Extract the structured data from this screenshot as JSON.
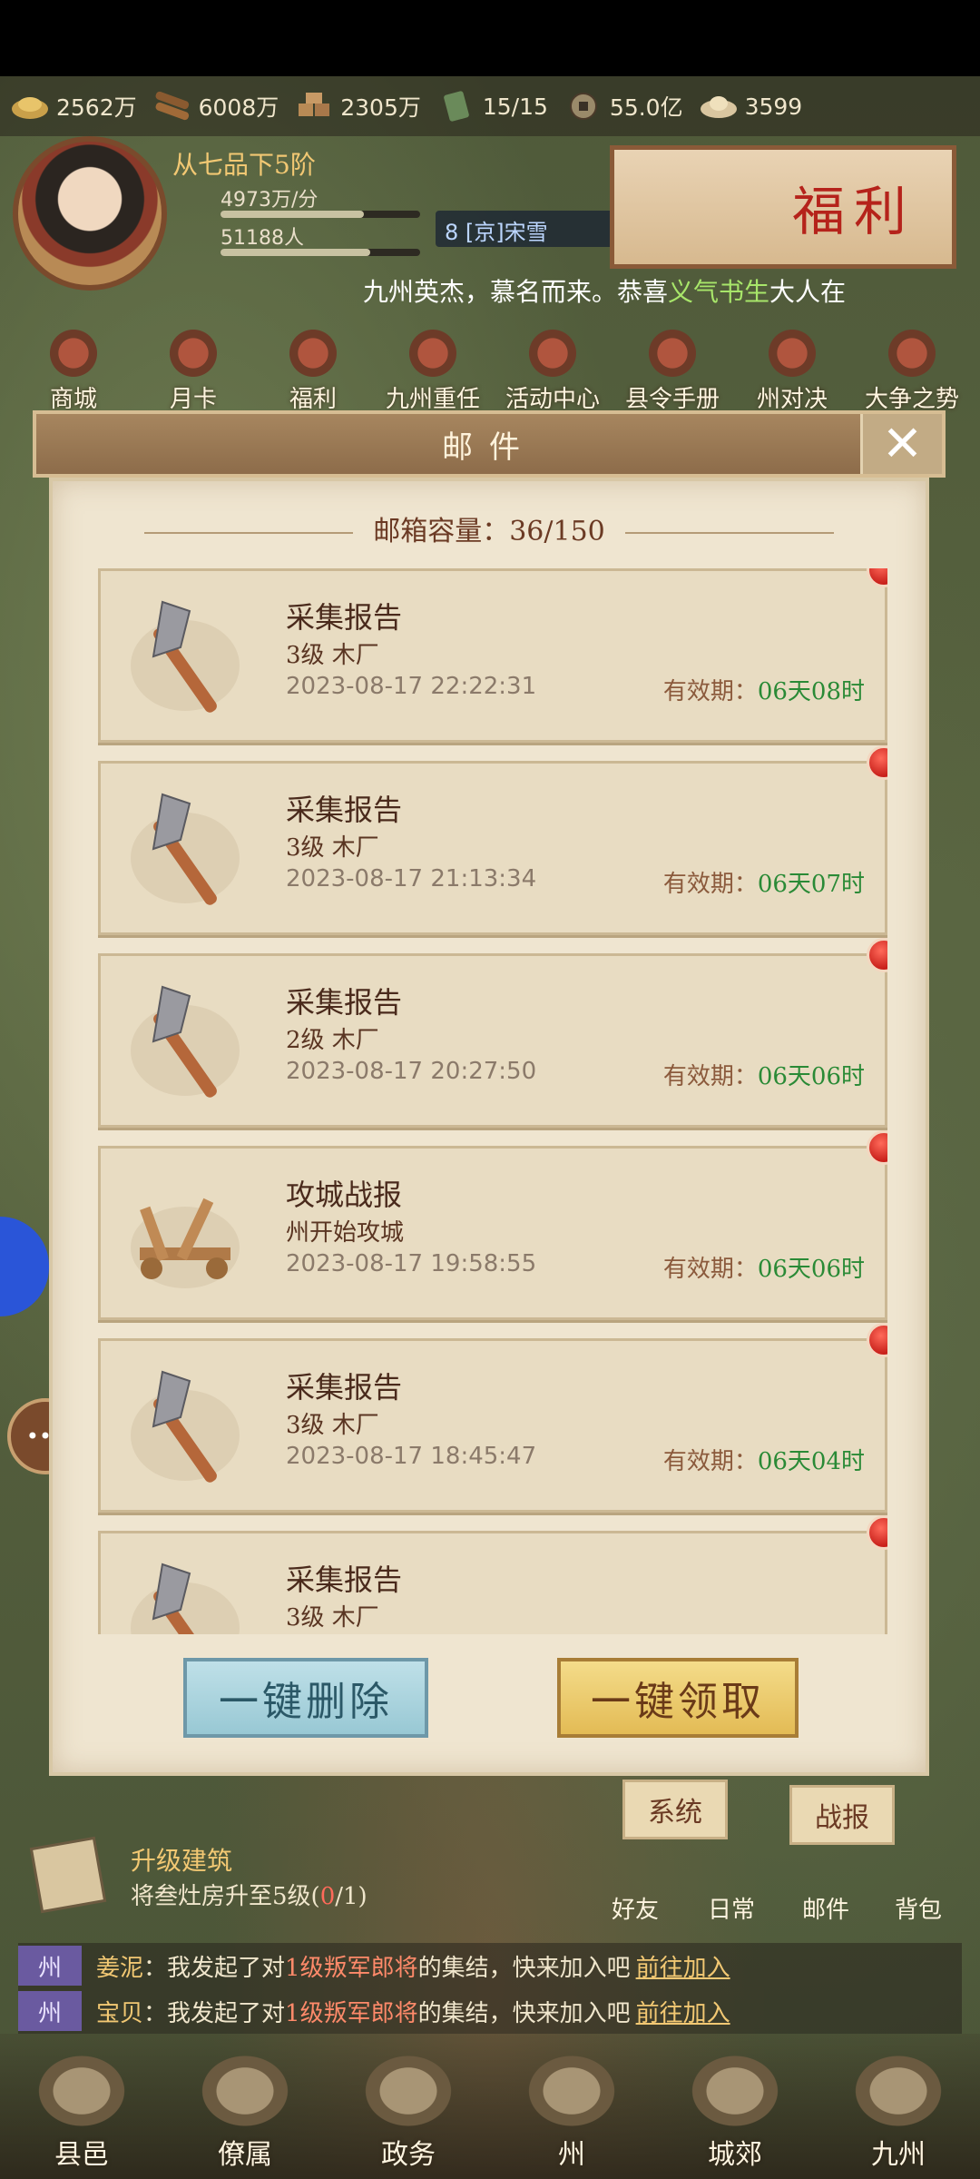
{
  "resources": [
    {
      "icon": "gold-ingot-icon",
      "value": "2562万"
    },
    {
      "icon": "wood-logs-icon",
      "value": "6008万"
    },
    {
      "icon": "stone-blocks-icon",
      "value": "2305万"
    },
    {
      "icon": "order-token-icon",
      "value": "15/15"
    },
    {
      "icon": "copper-coin-icon",
      "value": "55.0亿"
    },
    {
      "icon": "ingot-currency-icon",
      "value": "3599"
    }
  ],
  "player": {
    "rank": "从七品下5阶",
    "rate": "4973万/分",
    "population": "51188人",
    "rate_progress": 0.72,
    "pop_progress": 0.75,
    "channel_tag": "8 [京]宋雪"
  },
  "welfare_banner": "福利",
  "marquee": {
    "prefix": "九州英杰，慕名而来。恭喜",
    "name": "义气书生",
    "suffix": "大人在"
  },
  "shortcuts": [
    "商城",
    "月卡",
    "福利",
    "九州重任",
    "活动中心",
    "县令手册",
    "州对决",
    "大争之势"
  ],
  "mail_dialog": {
    "title": "邮件",
    "close": "✕",
    "capacity_label": "邮箱容量：",
    "capacity_value": "36/150",
    "expire_label": "有效期：",
    "items": [
      {
        "icon": "axe-icon",
        "title": "采集报告",
        "sub": "3级  木厂",
        "time": "2023-08-17  22:22:31",
        "expire": "06天08时"
      },
      {
        "icon": "axe-icon",
        "title": "采集报告",
        "sub": "3级  木厂",
        "time": "2023-08-17  21:13:34",
        "expire": "06天07时"
      },
      {
        "icon": "axe-icon",
        "title": "采集报告",
        "sub": "2级  木厂",
        "time": "2023-08-17  20:27:50",
        "expire": "06天06时"
      },
      {
        "icon": "catapult-icon",
        "title": "攻城战报",
        "sub": "州开始攻城",
        "time": "2023-08-17  19:58:55",
        "expire": "06天06时"
      },
      {
        "icon": "axe-icon",
        "title": "采集报告",
        "sub": "3级  木厂",
        "time": "2023-08-17  18:45:47",
        "expire": "06天04时"
      },
      {
        "icon": "axe-icon",
        "title": "采集报告",
        "sub": "3级  木厂",
        "time": "",
        "expire": ""
      }
    ],
    "delete_all": "一键删除",
    "claim_all": "一键领取",
    "tabs": [
      "系统",
      "战报"
    ]
  },
  "task": {
    "title": "升级建筑",
    "desc_prefix": "将叁灶房升至5级(",
    "progress": "0",
    "desc_suffix": "/1)"
  },
  "quick_buttons": [
    "好友",
    "日常",
    "邮件",
    "背包"
  ],
  "chat": [
    {
      "tag": "州",
      "name": "姜泥",
      "msg_a": "：我发起了对",
      "target": "1级叛军郎将",
      "msg_b": "的集结，快来加入吧",
      "link": "前往加入"
    },
    {
      "tag": "州",
      "name": "宝贝",
      "msg_a": "：我发起了对",
      "target": "1级叛军郎将",
      "msg_b": "的集结，快来加入吧",
      "link": "前往加入"
    }
  ],
  "chat_badge": "8",
  "nav": [
    "县邑",
    "僚属",
    "政务",
    "州",
    "城郊",
    "九州"
  ]
}
